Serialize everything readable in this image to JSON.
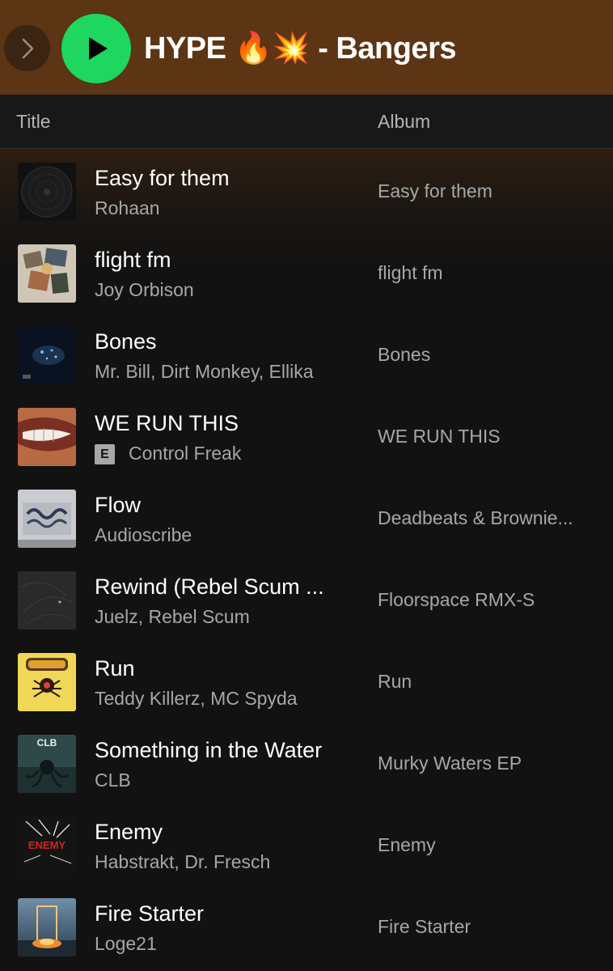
{
  "header": {
    "title": "HYPE 🔥💥 - Bangers",
    "back_icon": "chevron-right-icon",
    "play_icon": "play-icon",
    "colors": {
      "header_bg": "#5b3514",
      "play": "#1ed760"
    }
  },
  "columns": {
    "title": "Title",
    "album": "Album"
  },
  "tracks": [
    {
      "title": "Easy for them",
      "artist": "Rohaan",
      "album": "Easy for them",
      "explicit": false
    },
    {
      "title": "flight fm",
      "artist": "Joy Orbison",
      "album": "flight fm",
      "explicit": false
    },
    {
      "title": "Bones",
      "artist": "Mr. Bill, Dirt Monkey, Ellika",
      "album": "Bones",
      "explicit": false
    },
    {
      "title": "WE RUN THIS",
      "artist": "Control Freak",
      "album": "WE RUN THIS",
      "explicit": true,
      "explicit_label": "E"
    },
    {
      "title": "Flow",
      "artist": "Audioscribe",
      "album": "Deadbeats & Brownie...",
      "explicit": false
    },
    {
      "title": "Rewind (Rebel Scum ...",
      "artist": "Juelz, Rebel Scum",
      "album": "Floorspace RMX-S",
      "explicit": false
    },
    {
      "title": "Run",
      "artist": "Teddy Killerz, MC Spyda",
      "album": "Run",
      "explicit": false
    },
    {
      "title": "Something in the Water",
      "artist": "CLB",
      "album": "Murky Waters EP",
      "explicit": false,
      "cover_text": "CLB"
    },
    {
      "title": "Enemy",
      "artist": "Habstrakt, Dr. Fresch",
      "album": "Enemy",
      "explicit": false,
      "cover_text": "ENEMY"
    },
    {
      "title": "Fire Starter",
      "artist": "Loge21",
      "album": "Fire Starter",
      "explicit": false
    }
  ]
}
